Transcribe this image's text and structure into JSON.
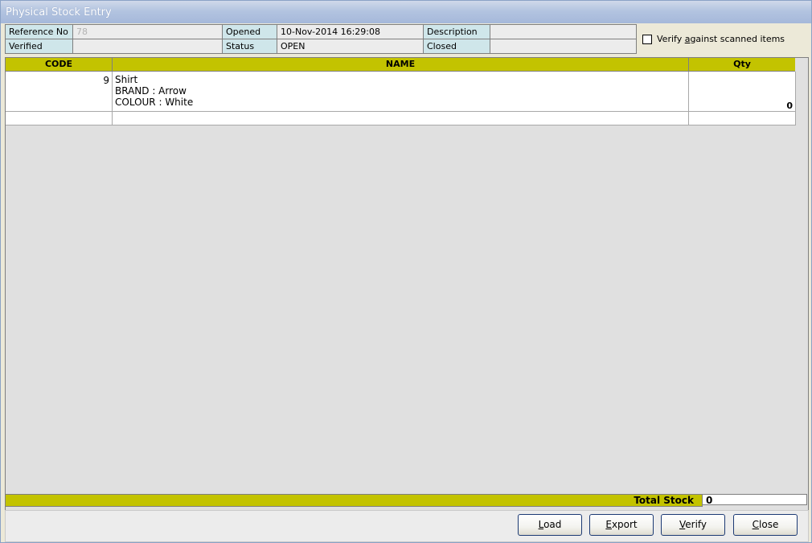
{
  "window": {
    "title": "Physical Stock Entry"
  },
  "header": {
    "reference_no_label": "Reference No",
    "reference_no_value": "78",
    "verified_label": "Verified",
    "verified_value": "",
    "opened_label": "Opened",
    "opened_value": "10-Nov-2014 16:29:08",
    "status_label": "Status",
    "status_value": "OPEN",
    "description_label": "Description",
    "description_value": "",
    "closed_label": "Closed",
    "closed_value": ""
  },
  "verify_checkbox": {
    "label_pre": "Verify ",
    "label_accel": "a",
    "label_post": "gainst scanned items",
    "checked": false
  },
  "grid": {
    "columns": {
      "code": "CODE",
      "name": "NAME",
      "qty": "Qty"
    },
    "rows": [
      {
        "code": "9",
        "name_lines": [
          "Shirt",
          "BRAND : Arrow",
          "COLOUR : White"
        ],
        "qty": "0"
      }
    ]
  },
  "footer": {
    "total_label": "Total Stock",
    "total_value": "0"
  },
  "buttons": {
    "load": {
      "accel": "L",
      "rest": "oad"
    },
    "export": {
      "accel": "E",
      "rest": "xport"
    },
    "verify": {
      "accel": "V",
      "rest": "erify"
    },
    "close": {
      "accel": "C",
      "rest": "lose"
    }
  },
  "colors": {
    "header_band": "#c3c300",
    "label_cell": "#cfe6ea",
    "titlebar": "#b3c4e0"
  }
}
